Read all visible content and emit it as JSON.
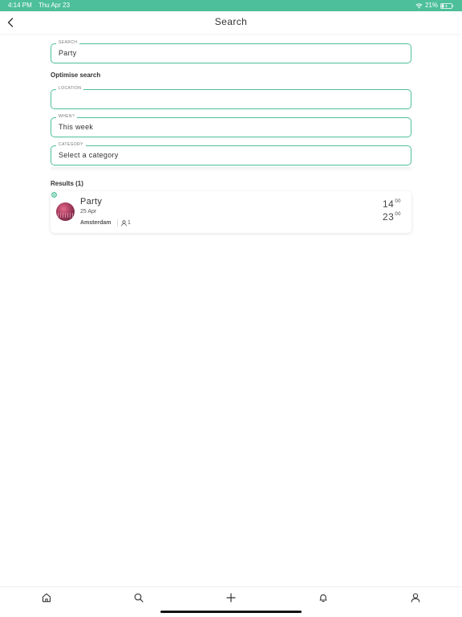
{
  "status_bar": {
    "time": "4:14 PM",
    "date": "Thu Apr 23",
    "battery": "21%",
    "icons": [
      "wifi-icon",
      "battery-icon"
    ]
  },
  "header": {
    "title": "Search",
    "back_icon": "chevron-left-icon"
  },
  "search": {
    "label": "SEARCH",
    "value": "Party"
  },
  "optimise": {
    "heading": "Optimise search",
    "location": {
      "label": "LOCATION",
      "value": ""
    },
    "when": {
      "label": "WHEN?",
      "value": "This week"
    },
    "category": {
      "label": "CATEGORY",
      "value": "Select a category"
    }
  },
  "results": {
    "heading": "Results (1)",
    "items": [
      {
        "title": "Party",
        "date": "25 Apr",
        "location": "Amsterdam",
        "attendees": "1",
        "start_hour": "14",
        "start_minutes": "00",
        "end_hour": "23",
        "end_minutes": "00"
      }
    ]
  },
  "tab_bar": {
    "tabs": [
      "home-icon",
      "search-icon",
      "plus-icon",
      "bell-icon",
      "user-icon"
    ]
  },
  "colors": {
    "accent": "#4dbf9a",
    "text": "#333333"
  }
}
